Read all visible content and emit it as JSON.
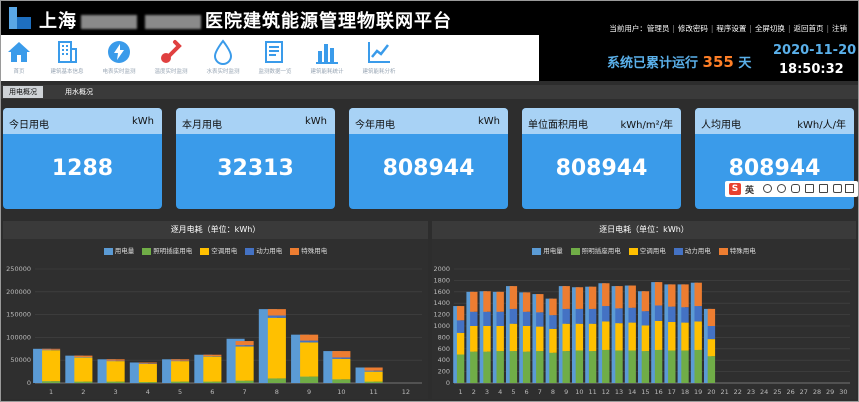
{
  "header": {
    "title_prefix": "上海",
    "title_suffix": "医院建筑能源管理物联网平台",
    "user_label": "当前用户：管理员",
    "links": [
      "修改密码",
      "程序设置",
      "全屏切换",
      "返回首页",
      "注销"
    ]
  },
  "nav": {
    "items": [
      {
        "label": "首页",
        "icon": "home-icon"
      },
      {
        "label": "建筑基本信息",
        "icon": "building-icon"
      },
      {
        "label": "电表实时监测",
        "icon": "lightning-icon"
      },
      {
        "label": "温度实时监测",
        "icon": "thermometer-icon"
      },
      {
        "label": "水表实时监测",
        "icon": "water-drop-icon"
      },
      {
        "label": "监测数据一览",
        "icon": "data-list-icon"
      },
      {
        "label": "建筑能耗统计",
        "icon": "bar-stats-icon"
      },
      {
        "label": "建筑能耗分析",
        "icon": "trend-chart-icon"
      }
    ],
    "nav_color": "#3a9bea"
  },
  "runtime": {
    "prefix": "系统已累计运行",
    "days": "355",
    "suffix": "天",
    "date": "2020-11-20",
    "time": "18:50:32"
  },
  "tabs": [
    "用电概况",
    "用水概况"
  ],
  "cards": [
    {
      "name": "今日用电",
      "unit": "kWh",
      "value": "1288"
    },
    {
      "name": "本月用电",
      "unit": "kWh",
      "value": "32313"
    },
    {
      "name": "今年用电",
      "unit": "kWh",
      "value": "808944"
    },
    {
      "name": "单位面积用电",
      "unit": "kWh/m²/年",
      "value": "808944"
    },
    {
      "name": "人均用电",
      "unit": "kWh/人/年",
      "value": "808944"
    }
  ],
  "ime": {
    "logo": "S",
    "lang": "英"
  },
  "chart_data": [
    {
      "type": "bar",
      "title": "逐月电耗（单位：kWh）",
      "categories": [
        "1",
        "2",
        "3",
        "4",
        "5",
        "6",
        "7",
        "8",
        "9",
        "10",
        "11",
        "12"
      ],
      "yticks": [
        "0",
        "50000",
        "100000",
        "150000",
        "200000",
        "250000"
      ],
      "ylim": [
        0,
        250000
      ],
      "series": [
        {
          "name": "用电量",
          "color": "#5b9bd5",
          "values": [
            75000,
            60000,
            52000,
            45000,
            52000,
            62000,
            97000,
            162000,
            106000,
            70000,
            34000,
            0
          ]
        },
        {
          "name": "照明插座用电",
          "color": "#70ad47",
          "values": [
            4000,
            3000,
            3000,
            2000,
            3000,
            3000,
            5000,
            10000,
            14000,
            8000,
            3000,
            0
          ]
        },
        {
          "name": "空调用电",
          "color": "#ffc000",
          "values": [
            68000,
            53000,
            45000,
            40000,
            45000,
            55000,
            75000,
            133000,
            75000,
            45000,
            22000,
            0
          ]
        },
        {
          "name": "动力用电",
          "color": "#4472c4",
          "values": [
            1000,
            1000,
            1000,
            1000,
            1000,
            1000,
            3000,
            5000,
            4000,
            3000,
            2000,
            0
          ]
        },
        {
          "name": "特殊用电",
          "color": "#ed7d31",
          "values": [
            2000,
            3000,
            3000,
            2000,
            3000,
            3000,
            9000,
            14000,
            13000,
            14000,
            7000,
            0
          ]
        }
      ],
      "legend": "top-center",
      "grid": true
    },
    {
      "type": "bar",
      "title": "逐日电耗（单位：kWh）",
      "categories": [
        "1",
        "2",
        "3",
        "4",
        "5",
        "6",
        "7",
        "8",
        "9",
        "10",
        "11",
        "12",
        "13",
        "14",
        "15",
        "16",
        "17",
        "18",
        "19",
        "20",
        "21",
        "22",
        "23",
        "24",
        "25",
        "26",
        "27",
        "28",
        "29",
        "30"
      ],
      "yticks": [
        "0",
        "200",
        "400",
        "600",
        "800",
        "1000",
        "1200",
        "1400",
        "1600",
        "1800",
        "2000"
      ],
      "ylim": [
        0,
        2000
      ],
      "series": [
        {
          "name": "用电量",
          "color": "#5b9bd5",
          "values": [
            1350,
            1600,
            1610,
            1600,
            1700,
            1590,
            1560,
            1480,
            1700,
            1680,
            1690,
            1750,
            1700,
            1710,
            1610,
            1770,
            1730,
            1730,
            1760,
            1300,
            0,
            0,
            0,
            0,
            0,
            0,
            0,
            0,
            0,
            0
          ]
        },
        {
          "name": "照明插座用电",
          "color": "#70ad47",
          "values": [
            500,
            550,
            550,
            560,
            560,
            550,
            560,
            530,
            560,
            570,
            560,
            580,
            570,
            570,
            560,
            580,
            570,
            570,
            580,
            470,
            0,
            0,
            0,
            0,
            0,
            0,
            0,
            0,
            0,
            0
          ]
        },
        {
          "name": "空调用电",
          "color": "#ffc000",
          "values": [
            380,
            450,
            450,
            440,
            480,
            450,
            430,
            420,
            480,
            470,
            480,
            500,
            480,
            490,
            450,
            510,
            500,
            490,
            500,
            300,
            0,
            0,
            0,
            0,
            0,
            0,
            0,
            0,
            0,
            0
          ]
        },
        {
          "name": "动力用电",
          "color": "#4472c4",
          "values": [
            220,
            250,
            250,
            250,
            260,
            250,
            250,
            240,
            260,
            260,
            260,
            270,
            260,
            260,
            250,
            270,
            270,
            270,
            270,
            230,
            0,
            0,
            0,
            0,
            0,
            0,
            0,
            0,
            0,
            0
          ]
        },
        {
          "name": "特殊用电",
          "color": "#ed7d31",
          "values": [
            250,
            350,
            360,
            350,
            400,
            340,
            320,
            290,
            400,
            380,
            390,
            400,
            390,
            390,
            350,
            410,
            390,
            400,
            410,
            300,
            0,
            0,
            0,
            0,
            0,
            0,
            0,
            0,
            0,
            0
          ]
        }
      ],
      "legend": "top-center",
      "grid": true
    }
  ]
}
